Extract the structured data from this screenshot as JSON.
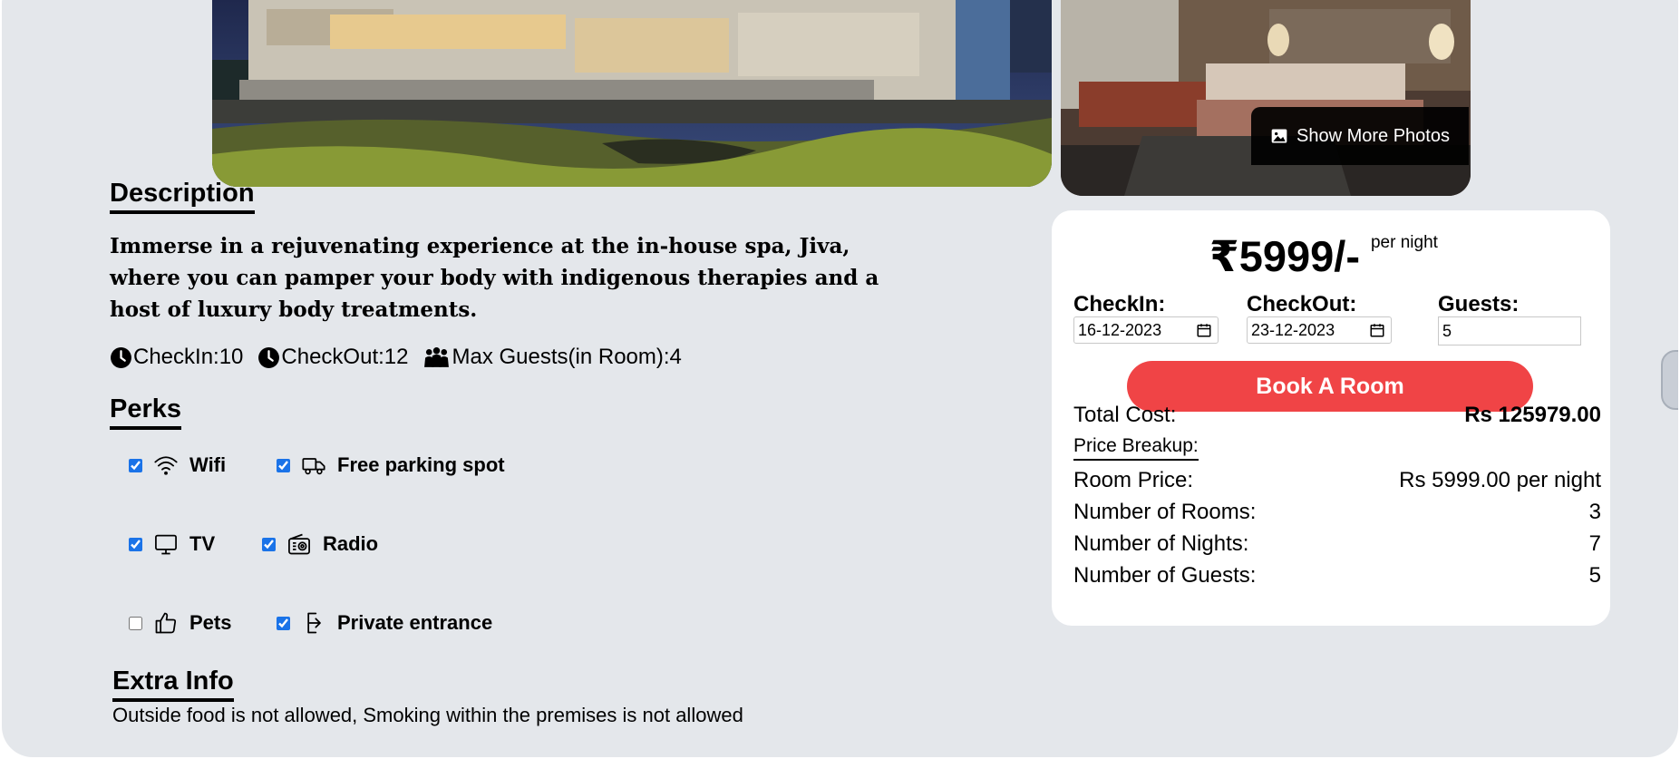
{
  "gallery": {
    "show_more_label": "Show More Photos"
  },
  "description": {
    "heading": "Description",
    "text": "Immerse in a rejuvenating experience at the in-house spa, Jiva, where you can pamper your body with indigenous therapies and a host of luxury body treatments.",
    "checkin_time": "CheckIn:10",
    "checkout_time": "CheckOut:12",
    "max_guests": "Max Guests(in Room):4"
  },
  "perks": {
    "heading": "Perks",
    "items": [
      {
        "label": "Wifi",
        "icon": "wifi-icon",
        "checked": true
      },
      {
        "label": "Free parking spot",
        "icon": "truck-icon",
        "checked": true
      },
      {
        "label": "TV",
        "icon": "monitor-icon",
        "checked": true
      },
      {
        "label": "Radio",
        "icon": "radio-icon",
        "checked": true
      },
      {
        "label": "Pets",
        "icon": "thumbs-up-icon",
        "checked": false
      },
      {
        "label": "Private entrance",
        "icon": "entrance-icon",
        "checked": true
      }
    ]
  },
  "extra_info": {
    "heading": "Extra Info",
    "text": "Outside food is not allowed, Smoking within the premises is not allowed"
  },
  "booking": {
    "price": "₹5999/-",
    "price_unit": "per night",
    "checkin_label": "CheckIn:",
    "checkin_value": "16-12-2023",
    "checkout_label": "CheckOut:",
    "checkout_value": "23-12-2023",
    "guests_label": "Guests:",
    "guests_value": "5",
    "book_button": "Book A Room",
    "total_label": "Total Cost:",
    "total_value": "Rs 125979.00",
    "breakup_label": "Price Breakup:",
    "breakup": [
      {
        "label": "Room Price:",
        "value": "Rs 5999.00 per night"
      },
      {
        "label": "Number of Rooms:",
        "value": "3"
      },
      {
        "label": "Number of Nights:",
        "value": "7"
      },
      {
        "label": "Number of Guests:",
        "value": "5"
      }
    ],
    "accent_color": "#f04446"
  }
}
